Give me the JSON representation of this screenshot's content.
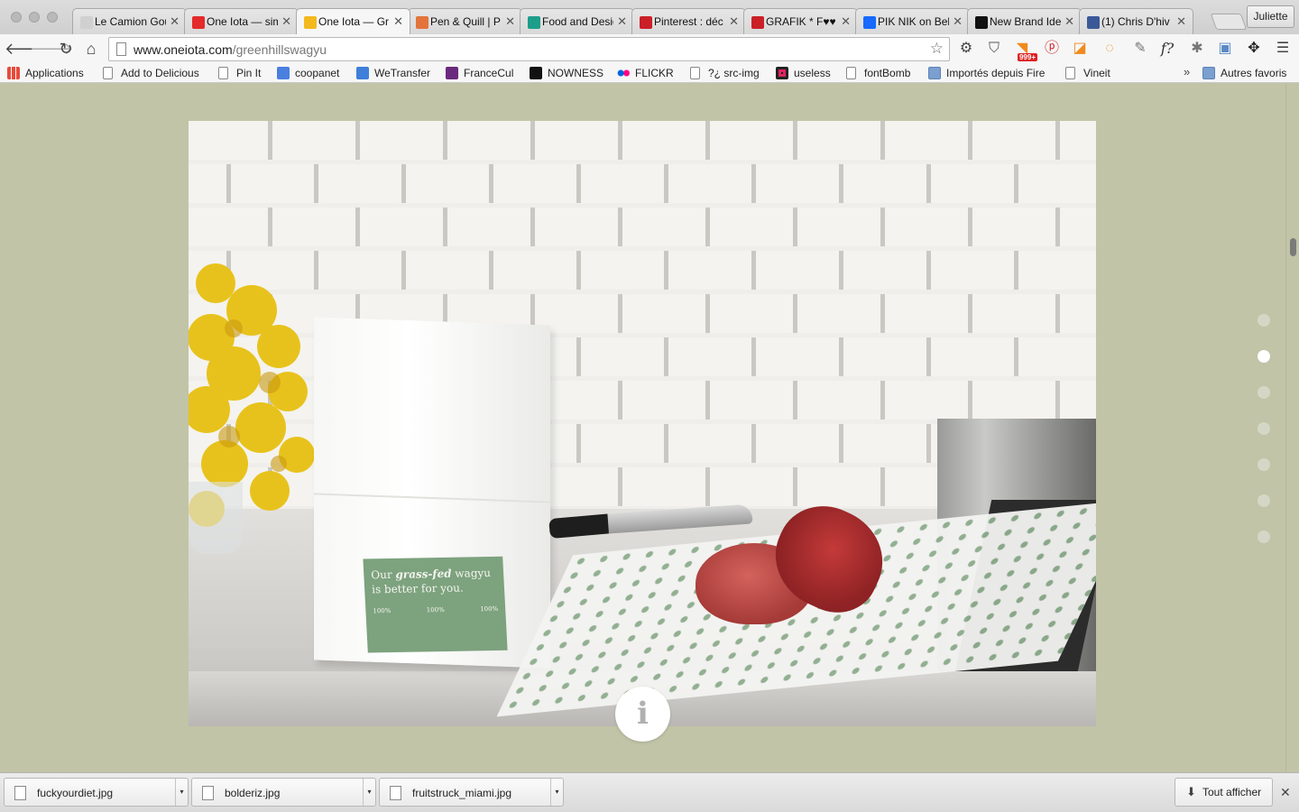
{
  "window": {
    "profile_name": "Juliette"
  },
  "tabs": [
    {
      "title": "Le Camion Gou",
      "favicon_color": "#d0d0d0"
    },
    {
      "title": "One Iota — sim",
      "favicon_color": "#e42a2a"
    },
    {
      "title": "One Iota — Gr",
      "favicon_color": "#f3b91e",
      "active": true
    },
    {
      "title": "Pen & Quill | P",
      "favicon_color": "#e3743b"
    },
    {
      "title": "Food and Desig",
      "favicon_color": "#1c9e8a"
    },
    {
      "title": "Pinterest : déc",
      "favicon_color": "#cb2027"
    },
    {
      "title": "GRAFIK * F♥♥",
      "favicon_color": "#cb2027"
    },
    {
      "title": "PIK NIK on Beh",
      "favicon_color": "#1769ff"
    },
    {
      "title": "New Brand Ide",
      "favicon_color": "#111111"
    },
    {
      "title": "(1) Chris D'hiv",
      "favicon_color": "#3b5998"
    }
  ],
  "toolbar": {
    "url_domain": "www.oneiota.com",
    "url_path": "/greenhillswagyu",
    "rss_badge": "999+"
  },
  "bookmarks": [
    {
      "label": "Applications",
      "icon": "apps-grid-icon"
    },
    {
      "label": "Add to Delicious",
      "icon": "page-icon"
    },
    {
      "label": "Pin It",
      "icon": "page-icon"
    },
    {
      "label": "coopanet",
      "icon": "google-icon"
    },
    {
      "label": "WeTransfer",
      "icon": "wetransfer-icon"
    },
    {
      "label": "FranceCul",
      "icon": "franceculture-icon"
    },
    {
      "label": "NOWNESS",
      "icon": "nowness-icon"
    },
    {
      "label": "FLICKR",
      "icon": "flickr-icon"
    },
    {
      "label": "?¿ src-img",
      "icon": "page-icon"
    },
    {
      "label": "useless",
      "icon": "useless-icon"
    },
    {
      "label": "fontBomb",
      "icon": "page-icon"
    },
    {
      "label": "Importés depuis Fire",
      "icon": "folder-icon"
    },
    {
      "label": "Vineit",
      "icon": "page-icon"
    }
  ],
  "bookmarks_more": "»",
  "bookmarks_other": "Autres favoris",
  "hero": {
    "bag_label_line1": "Our",
    "bag_label_emph": "grass-fed",
    "bag_label_line2": "wagyu is better for you.",
    "bag_stats": [
      "100%",
      "100%",
      "100%"
    ]
  },
  "info_button": "i",
  "slide_nav": {
    "count": 7,
    "active_index": 1
  },
  "downloads": [
    {
      "filename": "fuckyourdiet.jpg"
    },
    {
      "filename": "bolderiz.jpg"
    },
    {
      "filename": "fruitstruck_miami.jpg"
    }
  ],
  "downloads_show_all": "Tout afficher",
  "colors": {
    "page_background": "#c1c4a7",
    "label_green": "#7da27e"
  }
}
